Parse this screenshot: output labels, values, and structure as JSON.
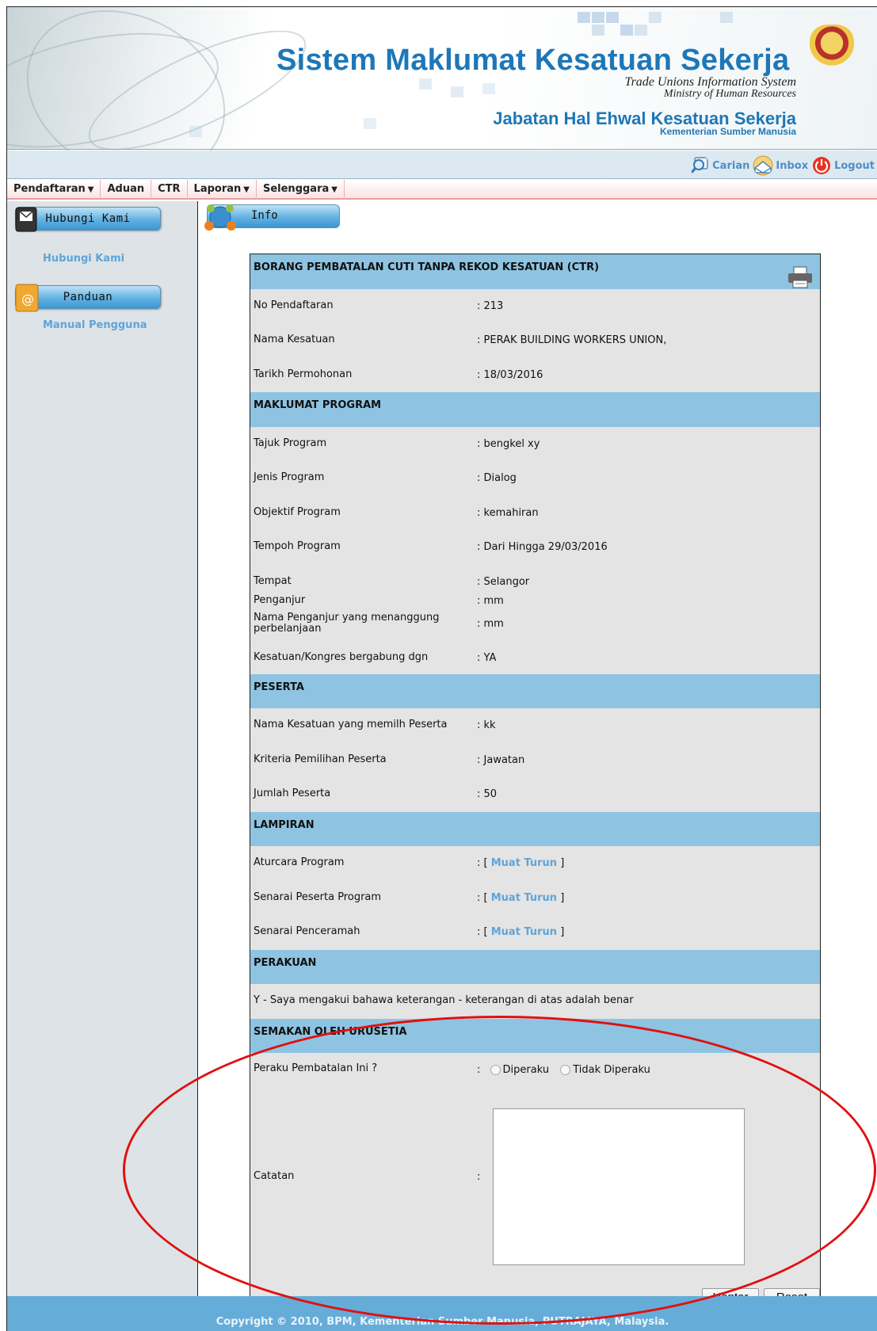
{
  "header": {
    "title": "Sistem Maklumat Kesatuan Sekerja",
    "subtitle_en": "Trade Unions Information System",
    "ministry_en": "Ministry of Human Resources",
    "department": "Jabatan Hal Ehwal Kesatuan Sekerja",
    "ministry_ms": "Kementerian Sumber Manusia"
  },
  "toolbar": {
    "search_label": "Carian",
    "inbox_label": "Inbox",
    "logout_label": "Logout"
  },
  "menu": {
    "items": [
      {
        "label": "Pendaftaran",
        "has_dropdown": true
      },
      {
        "label": "Aduan",
        "has_dropdown": false
      },
      {
        "label": "CTR",
        "has_dropdown": false
      },
      {
        "label": "Laporan",
        "has_dropdown": true
      },
      {
        "label": "Selenggara",
        "has_dropdown": true
      }
    ]
  },
  "sidebar": {
    "contact_button": "Hubungi Kami",
    "contact_link": "Hubungi Kami",
    "guide_button": "Panduan",
    "guide_link": "Manual Pengguna"
  },
  "main": {
    "info_tab": "Info",
    "form_title": "BORANG PEMBATALAN CUTI TANPA REKOD KESATUAN (CTR)",
    "fields": {
      "no_pendaftaran": {
        "label": "No Pendaftaran",
        "value": ": 213"
      },
      "nama_kesatuan": {
        "label": "Nama Kesatuan",
        "value": ": PERAK BUILDING WORKERS UNION,"
      },
      "tarikh": {
        "label": "Tarikh Permohonan",
        "value": ": 18/03/2016"
      }
    },
    "program_section": "MAKLUMAT PROGRAM",
    "program": {
      "tajuk": {
        "label": "Tajuk Program",
        "value": ": bengkel xy"
      },
      "jenis": {
        "label": "Jenis Program",
        "value": ": Dialog"
      },
      "objektif": {
        "label": "Objektif Program",
        "value": ": kemahiran"
      },
      "tempoh": {
        "label": "Tempoh Program",
        "value": ": Dari Hingga 29/03/2016"
      },
      "tempat": {
        "label": "Tempat",
        "value": ": Selangor"
      },
      "penganjur": {
        "label": "Penganjur",
        "value": ": mm"
      },
      "penanggung": {
        "label": "Nama Penganjur yang menanggung perbelanjaan",
        "value": ": mm"
      },
      "kesatuan": {
        "label": "Kesatuan/Kongres bergabung dgn",
        "value": ": YA"
      }
    },
    "peserta_section": "PESERTA",
    "peserta": {
      "nama": {
        "label": "Nama Kesatuan yang memilh Peserta",
        "value": ": kk"
      },
      "kriteria": {
        "label": "Kriteria Pemilihan Peserta",
        "value": ": Jawatan"
      },
      "jumlah": {
        "label": "Jumlah Peserta",
        "value": ": 50"
      }
    },
    "lampiran_section": "LAMPIRAN",
    "lampiran": {
      "prefix": ": [",
      "suffix": "]",
      "link_text": "Muat Turun",
      "aturcara": "Aturcara Program",
      "senarai_peserta": "Senarai Peserta Program",
      "senarai_penceramah": "Senarai Penceramah"
    },
    "perakuan_section": "PERAKUAN",
    "perakuan_text": "Y - Saya mengakui bahawa keterangan - keterangan di atas adalah benar",
    "semakan_section": "SEMAKAN OLEH URUSETIA",
    "semakan": {
      "question": "Peraku Pembatalan Ini ?",
      "colon": ":",
      "option_yes": "Diperaku",
      "option_no": "Tidak Diperaku",
      "notes_label": "Catatan",
      "notes_value": ""
    },
    "submit_button": "Hantar",
    "reset_button": "Reset"
  },
  "footer": {
    "text": "Copyright © 2010, BPM, Kementerian Sumber Manusia, PUTRAJAYA, Malaysia."
  },
  "colors": {
    "brand_blue": "#1d77b8",
    "section_header": "#8ec4e2",
    "link": "#5fa4d8",
    "annotation_ellipse": "#e01010"
  }
}
